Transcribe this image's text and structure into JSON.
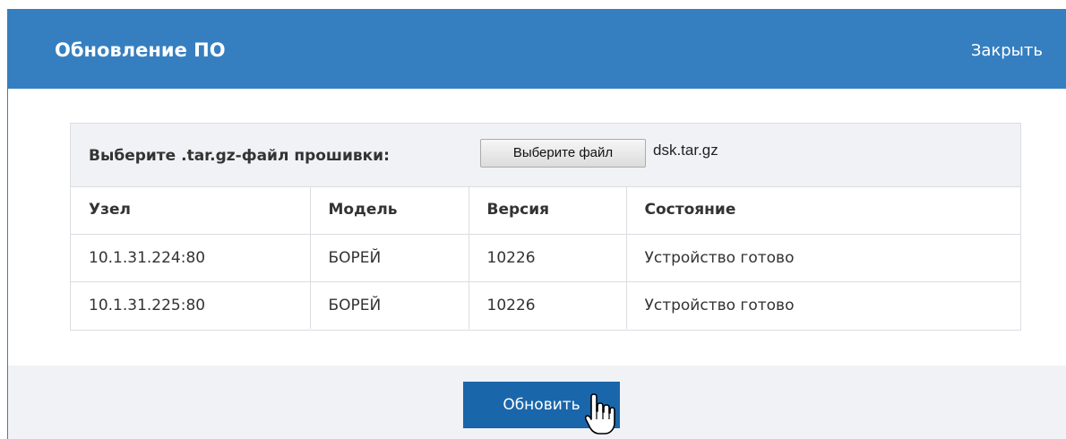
{
  "dialog": {
    "title": "Обновление ПО",
    "close_label": "Закрыть"
  },
  "file_picker": {
    "label": "Выберите .tar.gz-файл прошивки:",
    "button_label": "Выберите файл",
    "file_name": "dsk.tar.gz"
  },
  "table": {
    "columns": [
      "Узел",
      "Модель",
      "Версия",
      "Состояние"
    ],
    "rows": [
      [
        "10.1.31.224:80",
        "БОРЕЙ",
        "10226",
        "Устройство готово"
      ],
      [
        "10.1.31.225:80",
        "БОРЕЙ",
        "10226",
        "Устройство готово"
      ]
    ]
  },
  "footer": {
    "update_label": "Обновить"
  },
  "icons": {
    "cursor": "hand-pointer-icon"
  },
  "colors": {
    "header_bg": "#357fc0",
    "button_bg": "#1a66ab",
    "panel_bg": "#f1f2f5"
  }
}
